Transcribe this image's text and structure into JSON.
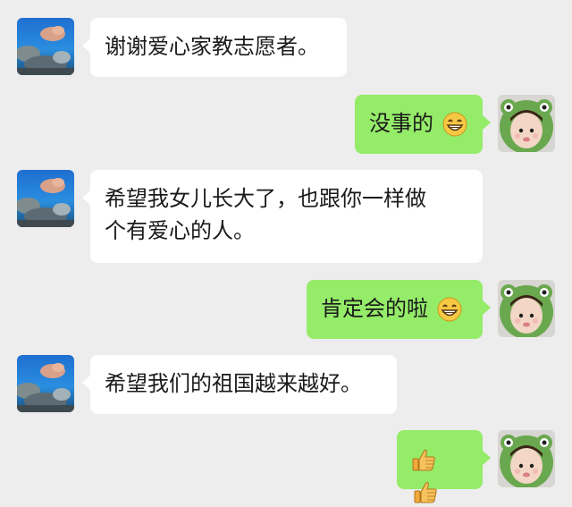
{
  "messages": [
    {
      "side": "left",
      "text": "谢谢爱心家教志愿者。"
    },
    {
      "side": "right",
      "text": "没事的",
      "emoji": "grinning-face-icon"
    },
    {
      "side": "left",
      "line1": "希望我女儿长大了，也跟你一样做",
      "line2": "个有爱心的人。"
    },
    {
      "side": "right",
      "text": "肯定会的啦",
      "emoji": "grinning-face-icon"
    },
    {
      "side": "left",
      "text": "希望我们的祖国越来越好。"
    },
    {
      "side": "right",
      "emoji": "thumbs-up-icon",
      "emoji_count": 2
    }
  ],
  "colors": {
    "background": "#ededed",
    "incoming_bubble": "#ffffff",
    "outgoing_bubble": "#95ec69",
    "text": "#1a1a1a"
  }
}
